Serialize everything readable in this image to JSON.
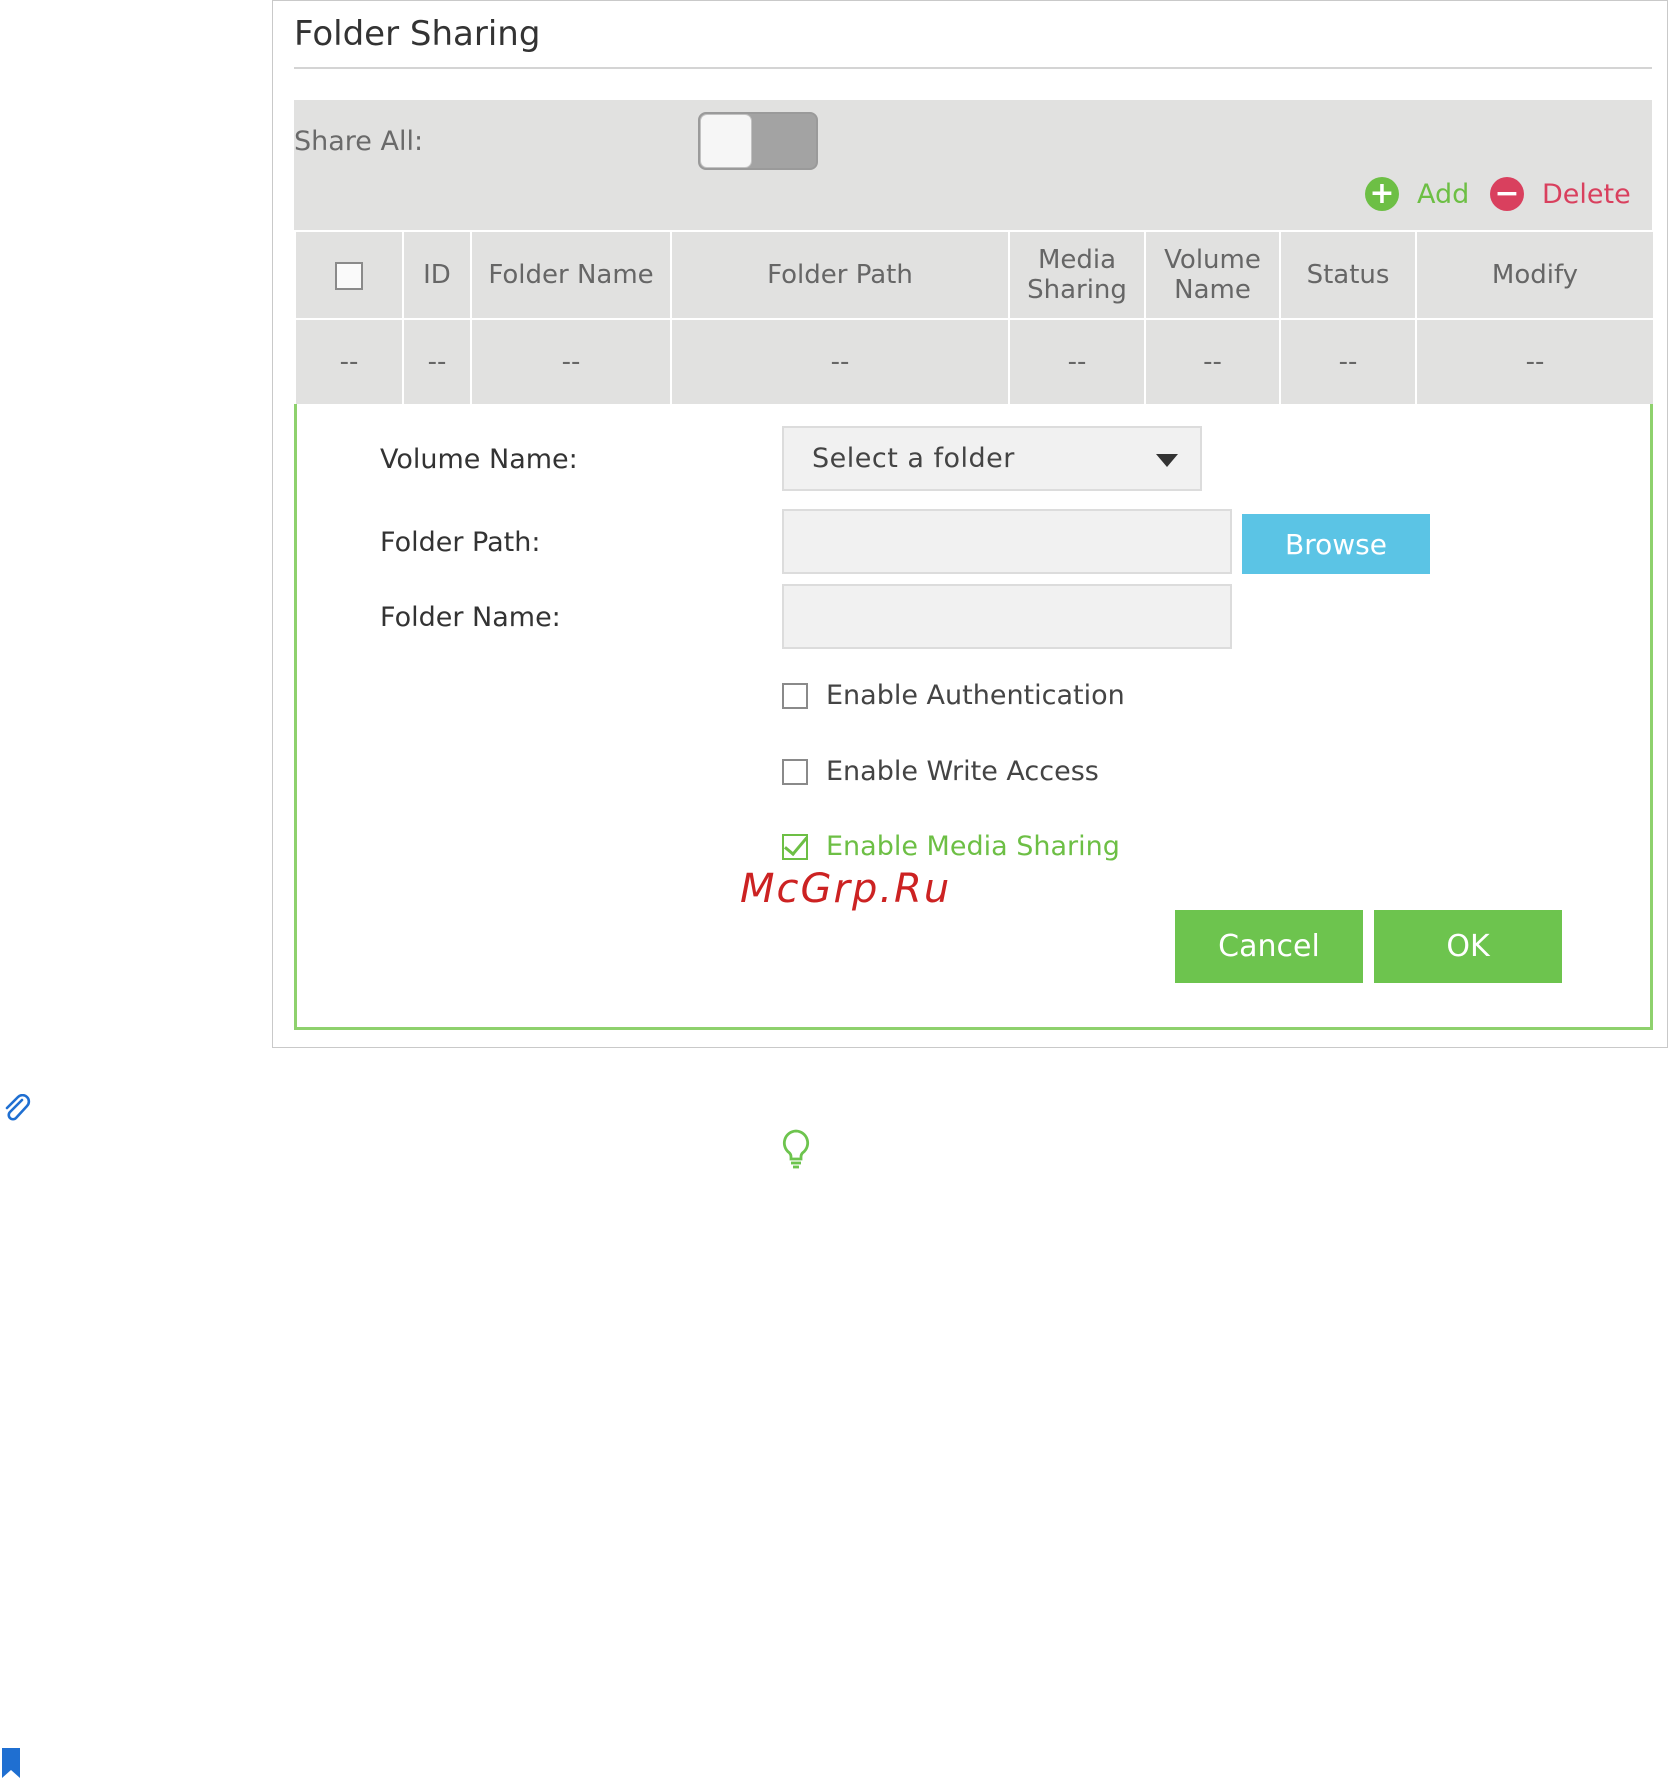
{
  "panel": {
    "title": "Folder Sharing"
  },
  "share_all": {
    "label": "Share All:",
    "enabled": false
  },
  "toolbar": {
    "add_label": "Add",
    "delete_label": "Delete",
    "add_icon": "plus-circle-icon",
    "delete_icon": "minus-circle-icon"
  },
  "table": {
    "headers": [
      "",
      "ID",
      "Folder Name",
      "Folder Path",
      "Media\nSharing",
      "Volume\nName",
      "Status",
      "Modify"
    ],
    "header_lines": {
      "media": [
        "Media",
        "Sharing"
      ],
      "volume": [
        "Volume",
        "Name"
      ]
    },
    "rows": [
      [
        "--",
        "--",
        "--",
        "--",
        "--",
        "--",
        "--",
        "--"
      ]
    ]
  },
  "form": {
    "volume_name_label": "Volume Name:",
    "volume_select_value": "Select a folder",
    "folder_path_label": "Folder Path:",
    "folder_path_value": "",
    "folder_name_label": "Folder Name:",
    "folder_name_value": "",
    "browse_label": "Browse",
    "checkboxes": [
      {
        "label": "Enable Authentication",
        "checked": false
      },
      {
        "label": "Enable Write Access",
        "checked": false
      },
      {
        "label": "Enable Media Sharing",
        "checked": true
      }
    ],
    "cancel_label": "Cancel",
    "ok_label": "OK"
  },
  "watermark": "McGrp.Ru",
  "colors": {
    "accent_green": "#6dc44e",
    "delete_red": "#d9405e",
    "browse_blue": "#5bc4e5",
    "form_border": "#8ed16d"
  },
  "icons": [
    "paperclip-icon",
    "lightbulb-icon",
    "bookmark-icon"
  ]
}
